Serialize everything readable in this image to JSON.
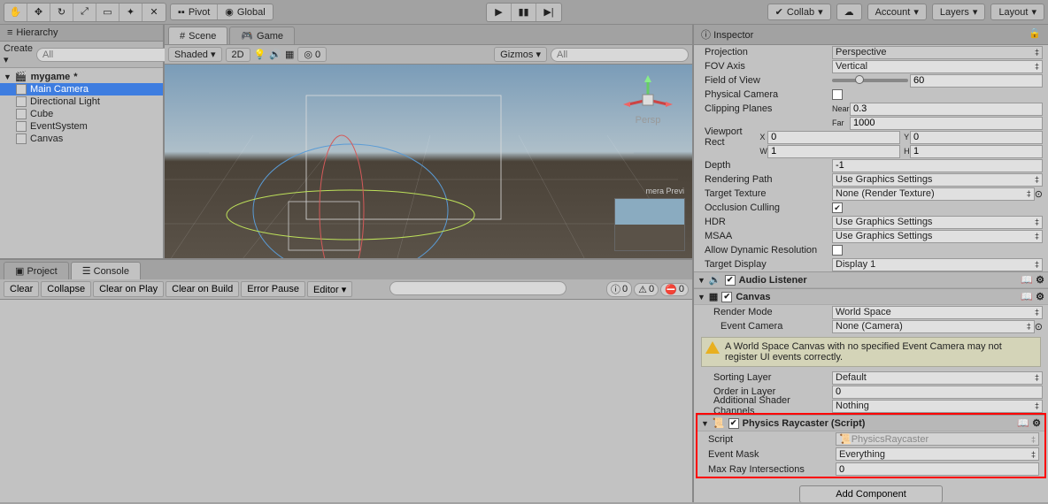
{
  "toolbar": {
    "pivot": "Pivot",
    "global": "Global",
    "collab": "Collab",
    "account": "Account",
    "layers": "Layers",
    "layout": "Layout"
  },
  "hierarchy": {
    "title": "Hierarchy",
    "create": "Create",
    "search_ph": "All",
    "scene": "mygame",
    "items": [
      "Main Camera",
      "Directional Light",
      "Cube",
      "EventSystem",
      "Canvas"
    ]
  },
  "scene": {
    "tab_scene": "Scene",
    "tab_game": "Game",
    "shaded": "Shaded",
    "mode_2d": "2D",
    "zero": "0",
    "gizmos": "Gizmos",
    "search_ph": "All",
    "persp": "Persp",
    "preview": "mera Previ"
  },
  "inspector": {
    "title": "Inspector",
    "projection": "Projection",
    "projection_v": "Perspective",
    "fov_axis": "FOV Axis",
    "fov_axis_v": "Vertical",
    "fov": "Field of View",
    "fov_v": "60",
    "phys_cam": "Physical Camera",
    "clipping": "Clipping Planes",
    "near": "Near",
    "near_v": "0.3",
    "far": "Far",
    "far_v": "1000",
    "viewport": "Viewport Rect",
    "x": "X",
    "x_v": "0",
    "y": "Y",
    "y_v": "0",
    "w": "W",
    "w_v": "1",
    "h": "H",
    "h_v": "1",
    "depth": "Depth",
    "depth_v": "-1",
    "rendering": "Rendering Path",
    "rendering_v": "Use Graphics Settings",
    "target_tex": "Target Texture",
    "target_tex_v": "None (Render Texture)",
    "occlusion": "Occlusion Culling",
    "hdr": "HDR",
    "hdr_v": "Use Graphics Settings",
    "msaa": "MSAA",
    "msaa_v": "Use Graphics Settings",
    "dyn_res": "Allow Dynamic Resolution",
    "target_disp": "Target Display",
    "target_disp_v": "Display 1",
    "audio": "Audio Listener",
    "canvas": "Canvas",
    "render_mode": "Render Mode",
    "render_mode_v": "World Space",
    "event_cam": "Event Camera",
    "event_cam_v": "None (Camera)",
    "warning": "A World Space Canvas with no specified Event Camera may not register UI events correctly.",
    "sorting": "Sorting Layer",
    "sorting_v": "Default",
    "order": "Order in Layer",
    "order_v": "0",
    "shader_ch": "Additional Shader Channels",
    "shader_ch_v": "Nothing",
    "physics": "Physics Raycaster (Script)",
    "script": "Script",
    "script_v": "PhysicsRaycaster",
    "event_mask": "Event Mask",
    "event_mask_v": "Everything",
    "max_ray": "Max Ray Intersections",
    "max_ray_v": "0",
    "add_comp": "Add Component"
  },
  "console": {
    "tab_project": "Project",
    "tab_console": "Console",
    "clear": "Clear",
    "collapse": "Collapse",
    "clear_play": "Clear on Play",
    "clear_build": "Clear on Build",
    "error_pause": "Error Pause",
    "editor": "Editor",
    "c0": "0",
    "c1": "0",
    "c2": "0"
  }
}
